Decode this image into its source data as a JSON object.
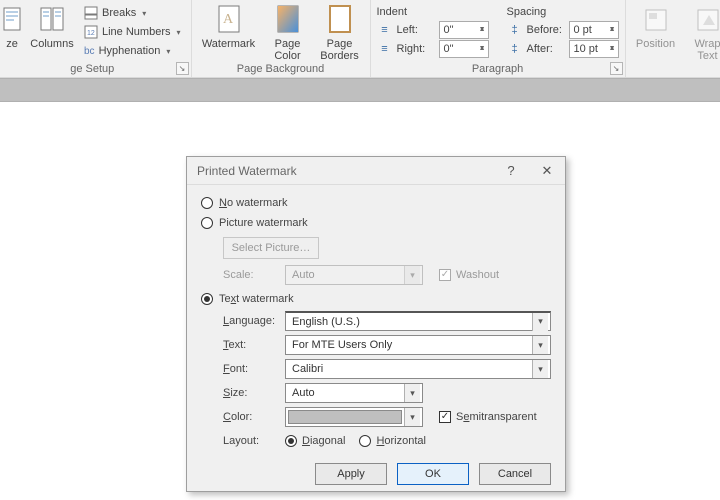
{
  "ribbon": {
    "pagesetup": {
      "title": "ge Setup",
      "size": "ze",
      "columns": "Columns",
      "breaks": "Breaks",
      "linenumbers": "Line Numbers",
      "hyphenation": "Hyphenation"
    },
    "pagebg": {
      "title": "Page Background",
      "watermark": "Watermark",
      "pagecolor": "Page\nColor",
      "pageborders": "Page\nBorders"
    },
    "paragraph": {
      "title": "Paragraph",
      "indent": "Indent",
      "spacing": "Spacing",
      "left": "Left:",
      "right": "Right:",
      "before": "Before:",
      "after": "After:",
      "left_v": "0\"",
      "right_v": "0\"",
      "before_v": "0 pt",
      "after_v": "10 pt"
    },
    "arrange": {
      "position": "Position",
      "wrap": "Wrap\nText"
    }
  },
  "dialog": {
    "title": "Printed Watermark",
    "no_wm": "No watermark",
    "pic_wm": "Picture watermark",
    "select_pic": "Select Picture…",
    "scale_lbl": "Scale:",
    "scale_v": "Auto",
    "washout": "Washout",
    "text_wm": "Text watermark",
    "language_lbl": "Language:",
    "language_v": "English (U.S.)",
    "text_lbl": "Text:",
    "text_v": "For MTE Users Only",
    "font_lbl": "Font:",
    "font_v": "Calibri",
    "size_lbl": "Size:",
    "size_v": "Auto",
    "color_lbl": "Color:",
    "semitrans": "Semitransparent",
    "layout_lbl": "Layout:",
    "diag": "Diagonal",
    "horiz": "Horizontal",
    "apply": "Apply",
    "ok": "OK",
    "cancel": "Cancel"
  }
}
